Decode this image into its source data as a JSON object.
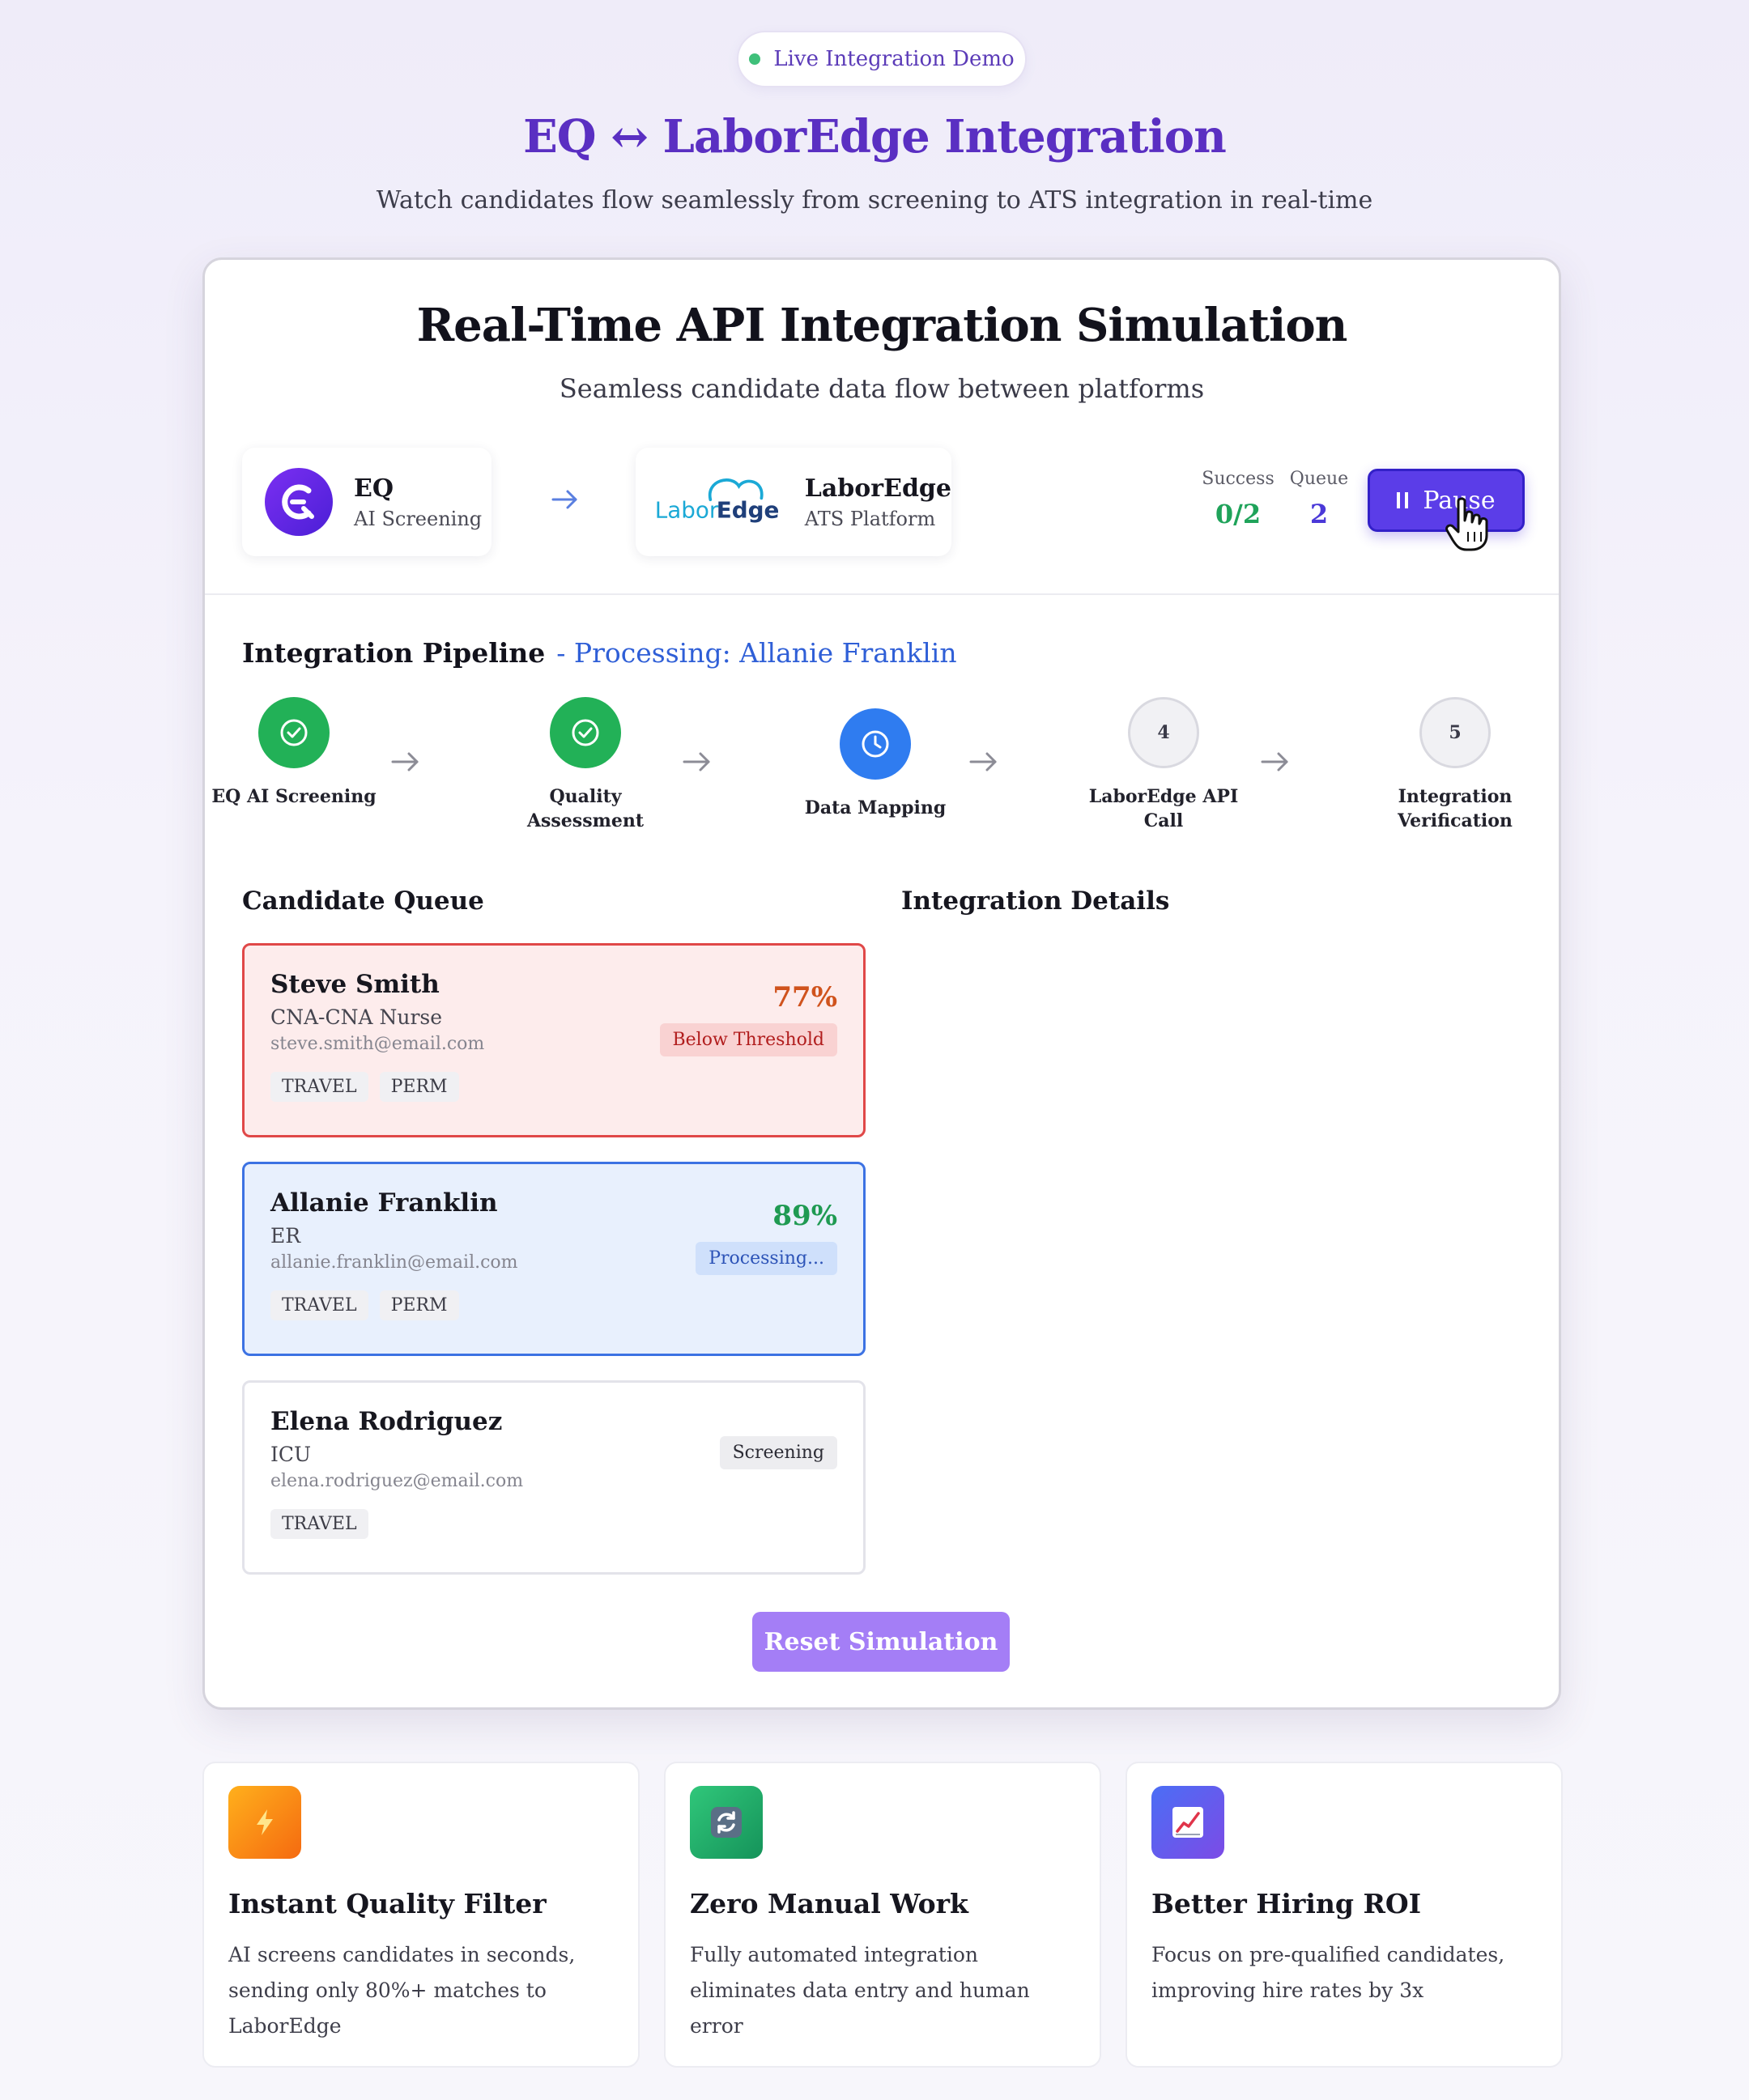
{
  "header": {
    "badge": "Live Integration Demo",
    "title": "EQ ↔ LaborEdge Integration",
    "subtitle": "Watch candidates flow seamlessly from screening to ATS integration in real-time"
  },
  "simulation": {
    "title": "Real-Time API Integration Simulation",
    "subtitle": "Seamless candidate data flow between platforms",
    "source": {
      "name": "EQ",
      "role": "AI Screening"
    },
    "target": {
      "name": "LaborEdge",
      "role": "ATS Platform",
      "logo_text_a": "Labor",
      "logo_text_b": "Edge"
    },
    "stats": {
      "success_label": "Success",
      "success_value": "0/2",
      "queue_label": "Queue",
      "queue_value": "2"
    },
    "pause_label": "Pause",
    "reset_label": "Reset Simulation"
  },
  "pipeline": {
    "title": "Integration Pipeline",
    "processing": "- Processing: Allanie Franklin",
    "steps": [
      {
        "label": "EQ AI Screening",
        "status": "done"
      },
      {
        "label": "Quality Assessment",
        "status": "done"
      },
      {
        "label": "Data Mapping",
        "status": "active"
      },
      {
        "label": "LaborEdge API Call",
        "number": "4",
        "status": "pending"
      },
      {
        "label": "Integration Verification",
        "number": "5",
        "status": "pending"
      }
    ]
  },
  "queue": {
    "title": "Candidate Queue",
    "candidates": [
      {
        "name": "Steve Smith",
        "role": "CNA-CNA Nurse",
        "email": "steve.smith@email.com",
        "score": "77%",
        "status": "Below Threshold",
        "tags": [
          "TRAVEL",
          "PERM"
        ]
      },
      {
        "name": "Allanie Franklin",
        "role": "ER",
        "email": "allanie.franklin@email.com",
        "score": "89%",
        "status": "Processing...",
        "tags": [
          "TRAVEL",
          "PERM"
        ]
      },
      {
        "name": "Elena Rodriguez",
        "role": "ICU",
        "email": "elena.rodriguez@email.com",
        "status": "Screening",
        "tags": [
          "TRAVEL"
        ]
      }
    ]
  },
  "details": {
    "title": "Integration Details"
  },
  "features": [
    {
      "title": "Instant Quality Filter",
      "text": "AI screens candidates in seconds, sending only 80%+ matches to LaborEdge",
      "icon": "lightning-icon"
    },
    {
      "title": "Zero Manual Work",
      "text": "Fully automated integration eliminates data entry and human error",
      "icon": "sync-icon"
    },
    {
      "title": "Better Hiring ROI",
      "text": "Focus on pre-qualified candidates, improving hire rates by 3x",
      "icon": "chart-up-icon"
    }
  ],
  "colors": {
    "brand_purple": "#5a2fc2",
    "success_green": "#22b157",
    "active_blue": "#2f7cf0",
    "fail_red": "#e04848"
  }
}
